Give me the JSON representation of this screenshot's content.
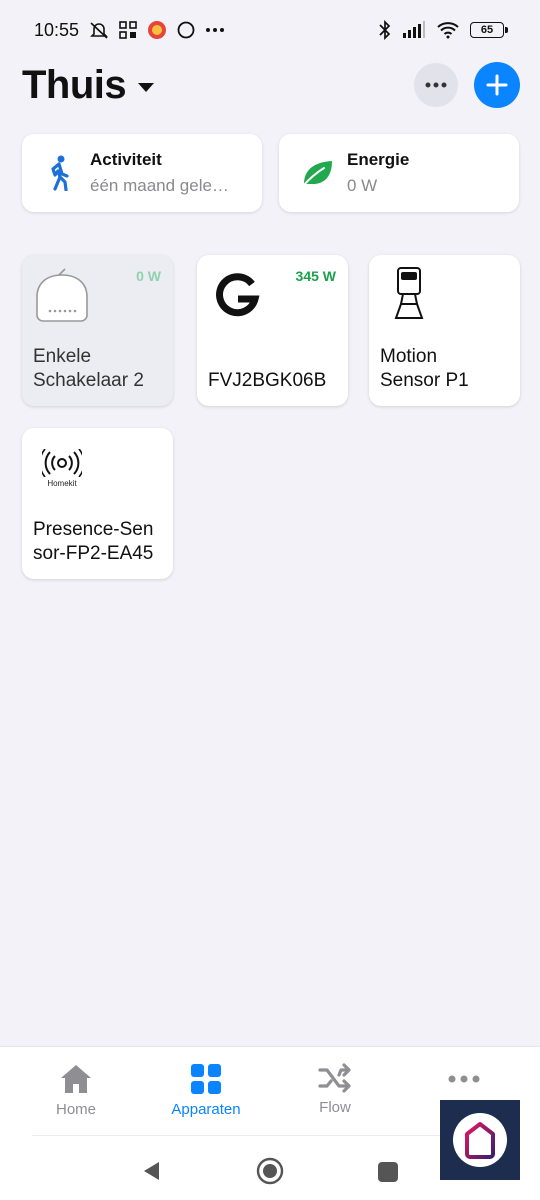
{
  "status_bar": {
    "time": "10:55",
    "battery": "65",
    "icons": [
      "mute-icon",
      "apps-grid-icon",
      "notification-badge-icon",
      "circle-icon",
      "more-icon",
      "bluetooth-icon",
      "signal-icon",
      "wifi-icon",
      "battery-icon"
    ]
  },
  "header": {
    "title": "Thuis",
    "more_icon": "ellipsis-icon",
    "add_icon": "plus-icon"
  },
  "summary": {
    "activity": {
      "title": "Activiteit",
      "subtitle": "één maand gele…",
      "icon": "walking-person-icon",
      "color": "#1e6fd9"
    },
    "energy": {
      "title": "Energie",
      "subtitle": "0 W",
      "icon": "leaf-icon",
      "color": "#22a84f"
    }
  },
  "devices": [
    {
      "name_line1": "Enkele",
      "name_line2": "Schakelaar 2",
      "power": "0 W",
      "icon": "switch-module-icon",
      "state": "off"
    },
    {
      "name_line1": "FVJ2BGK06B",
      "name_line2": "",
      "power": "345 W",
      "icon": "google-g-icon",
      "state": "on"
    },
    {
      "name_line1": "Motion",
      "name_line2": "Sensor P1",
      "power": "",
      "icon": "motion-sensor-icon",
      "state": "on"
    },
    {
      "name_line1": "Presence-Sen",
      "name_line2": "sor-FP2-EA45",
      "power": "",
      "icon": "homekit-icon",
      "icon_label": "Homekit",
      "state": "on"
    }
  ],
  "tabbar": {
    "tabs": [
      {
        "label": "Home",
        "icon": "house-icon",
        "active": false
      },
      {
        "label": "Apparaten",
        "icon": "grid-icon",
        "active": true
      },
      {
        "label": "Flow",
        "icon": "shuffle-icon",
        "active": false
      },
      {
        "label": "",
        "icon": "more-dots-icon",
        "active": false
      }
    ]
  },
  "colors": {
    "accent": "#0a84ff",
    "background": "#f2f2f8",
    "power_green": "#1aa14b"
  }
}
